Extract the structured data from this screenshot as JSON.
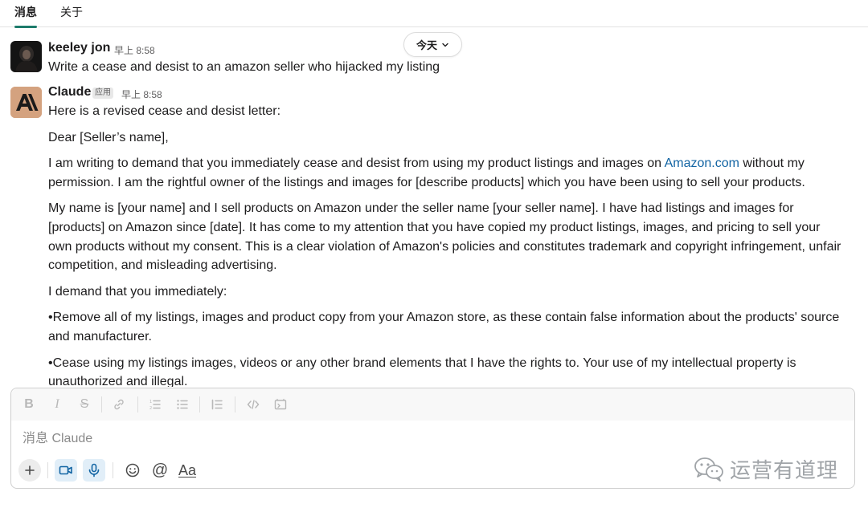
{
  "tabs": [
    {
      "label": "消息",
      "active": true
    },
    {
      "label": "关于",
      "active": false
    }
  ],
  "date_divider": {
    "label": "今天"
  },
  "messages": [
    {
      "sender": "keeley jon",
      "time": "早上 8:58",
      "text": "Write a cease and desist to an amazon seller who hijacked my listing"
    },
    {
      "sender": "Claude",
      "badge": "应用",
      "time": "早上 8:58",
      "paragraphs": {
        "p0": "Here is a revised cease and desist letter:",
        "p1": "Dear [Seller’s name],",
        "p2_before": "I am writing to demand that you immediately cease and desist from using my product listings and images on ",
        "p2_link": "Amazon.com",
        "p2_after": " without my permission. I am the rightful owner of the listings and images for [describe products] which you have been using to sell your products.",
        "p3": "My name is [your name] and I sell products on Amazon under the seller name [your seller name]. I have had listings and images for [products] on Amazon since [date]. It has come to my attention that you have copied my product listings, images, and pricing to sell your own products without my consent. This is a clear violation of Amazon's policies and constitutes trademark and copyright infringement, unfair competition, and misleading advertising.",
        "p4": "I demand that you immediately:",
        "p5": "•Remove all of my listings, images and product copy from your Amazon store, as these contain false information about the products' source and manufacturer.",
        "p6": "•Cease using my listings images, videos or any other brand elements that I have the rights to. Your use of my intellectual property is unauthorized and illegal."
      }
    }
  ],
  "composer": {
    "placeholder": "消息 Claude",
    "value": "",
    "format_icons": [
      "bold-icon",
      "italic-icon",
      "strikethrough-icon",
      "link-icon",
      "ordered-list-icon",
      "bullet-list-icon",
      "blockquote-icon",
      "code-icon",
      "code-block-icon"
    ],
    "format_labels": {
      "bold": "B",
      "italic": "I",
      "strike": "S"
    },
    "action_icons": [
      "plus-icon",
      "video-icon",
      "microphone-icon",
      "emoji-icon",
      "mention-icon",
      "formatting-icon"
    ],
    "mention_symbol": "@",
    "formatting_label": "Aa"
  },
  "watermark": {
    "text": "运营有道理"
  },
  "colors": {
    "accent": "#1d7b6b",
    "link": "#1264a3",
    "claude_avatar_bg": "#d4a27f",
    "highlight_bg": "#e1eef8"
  }
}
